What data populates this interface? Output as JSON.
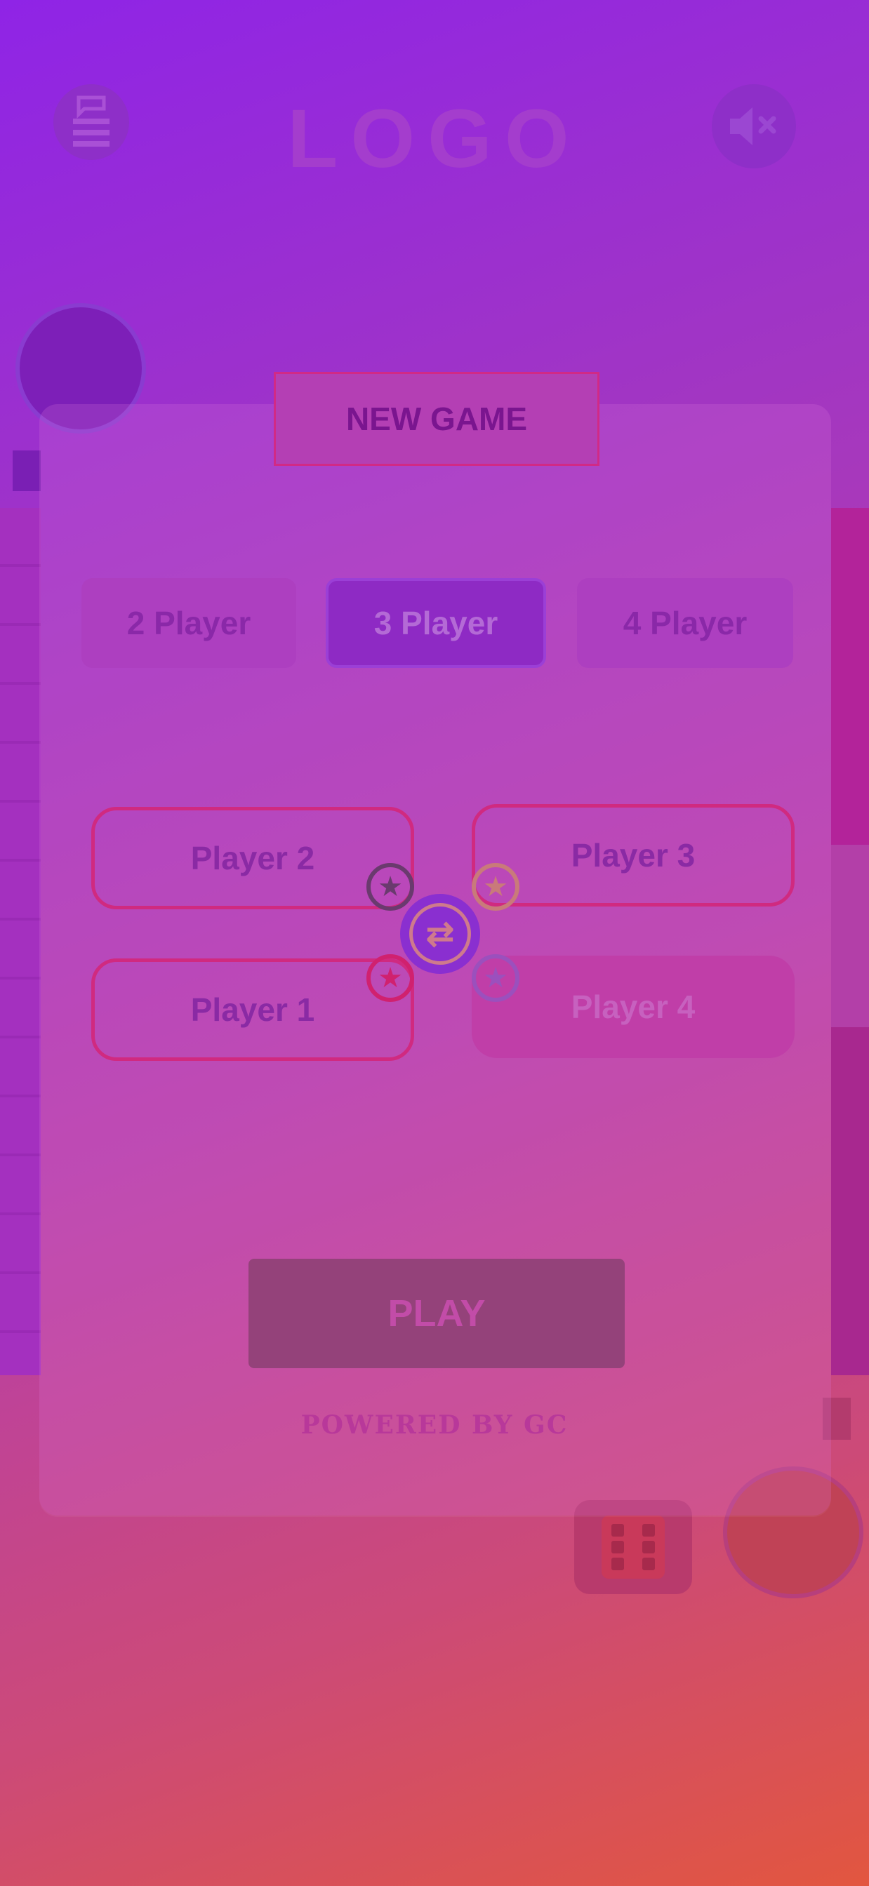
{
  "header": {
    "menu_icon": "layers-icon",
    "logo_text": "LOGO",
    "sound_icon": "mute-icon"
  },
  "modal": {
    "title": "NEW GAME",
    "modes": [
      {
        "label": "2 Player",
        "selected": false
      },
      {
        "label": "3 Player",
        "selected": true
      },
      {
        "label": "4 Player",
        "selected": false
      }
    ],
    "players": {
      "p1": "Player 1",
      "p2": "Player 2",
      "p3": "Player 3",
      "p4": "Player 4"
    },
    "swap_icon": "swap-arrows-icon",
    "play_label": "PLAY",
    "footer": "POWERED BY GC"
  },
  "colors": {
    "accent": "#d12a86",
    "selected_mode": "#8e2ac4",
    "play_button": "#94427a",
    "star_p1": "#d0216f",
    "star_p2": "#6a3a6e",
    "star_p3": "#c97a7a",
    "star_p4": "#9b50bd"
  }
}
